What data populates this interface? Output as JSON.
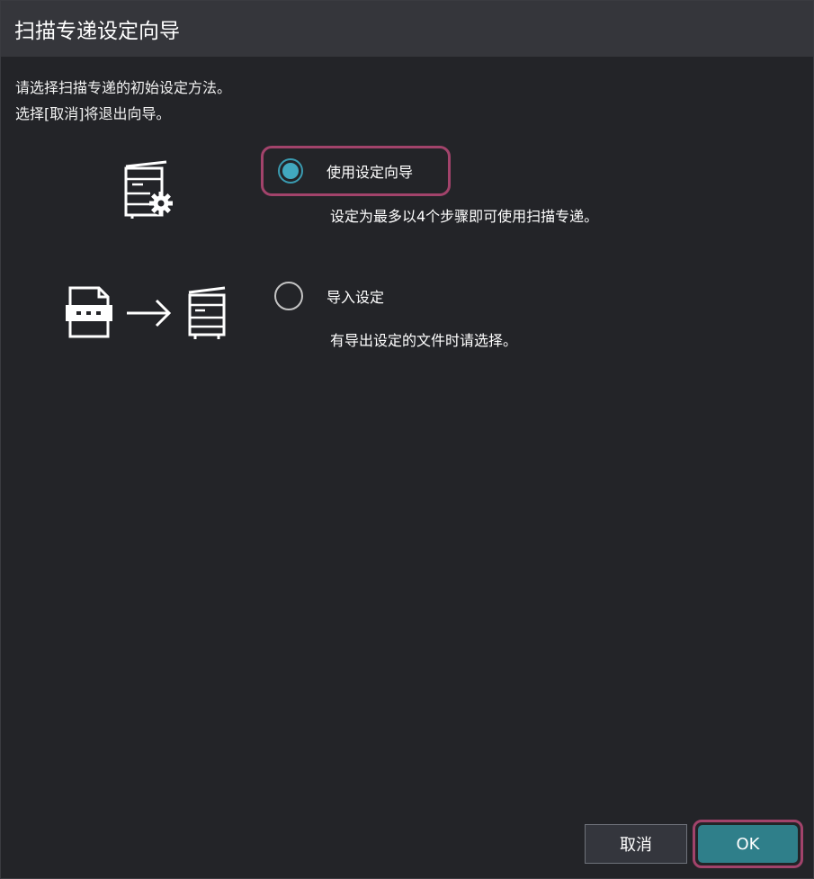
{
  "dialog": {
    "title": "扫描专递设定向导",
    "intro": {
      "line1": "请选择扫描专递的初始设定方法。",
      "line2": "选择[取消]将退出向导。"
    },
    "options": [
      {
        "label": "使用设定向导",
        "description": "设定为最多以4个步骤即可使用扫描专递。",
        "selected": true,
        "icon": "printer-settings-icon"
      },
      {
        "label": "导入设定",
        "description": "有导出设定的文件时请选择。",
        "selected": false,
        "icon": "file-to-printer-icon"
      }
    ],
    "buttons": {
      "cancel_label": "取消",
      "ok_label": "OK"
    }
  },
  "colors": {
    "background": "#232428",
    "titlebar": "#35363b",
    "focus_ring": "#a2436b",
    "radio_accent": "#41a8bf",
    "ok_button": "#2f7f8a",
    "cancel_button": "#34363d"
  }
}
